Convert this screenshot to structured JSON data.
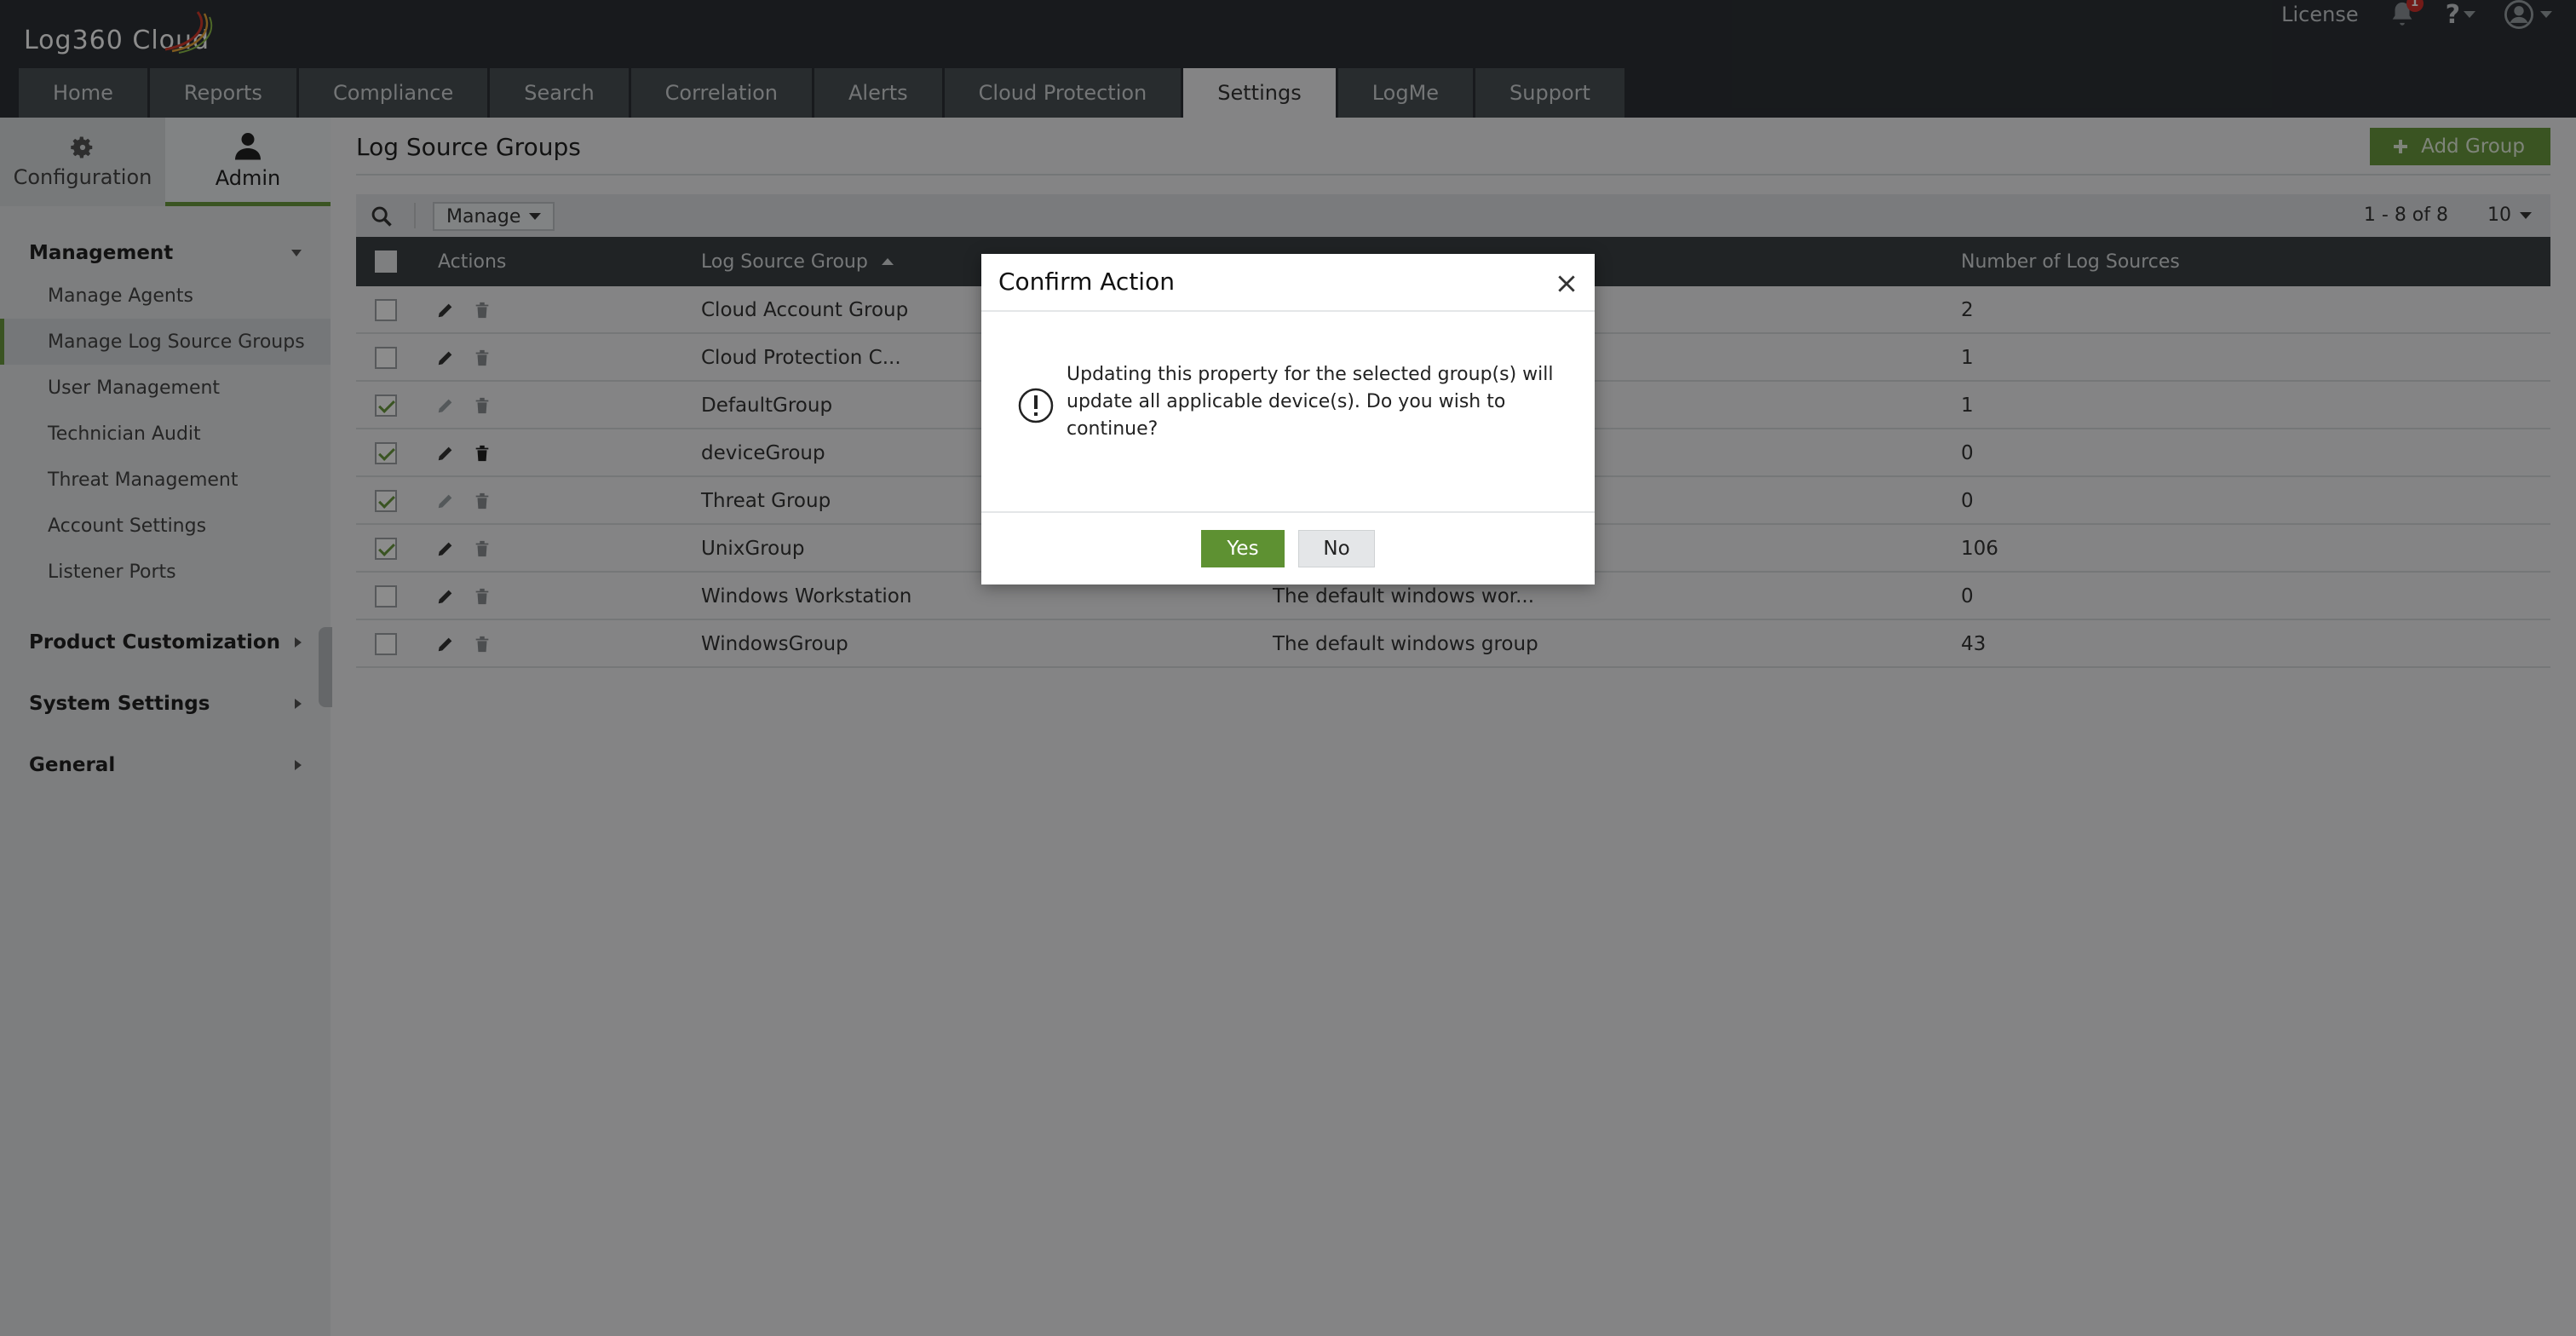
{
  "app": {
    "logo_text": "Log360 Cloud"
  },
  "header": {
    "license_label": "License",
    "notification_count": "1"
  },
  "nav": {
    "tabs": [
      {
        "label": "Home"
      },
      {
        "label": "Reports"
      },
      {
        "label": "Compliance"
      },
      {
        "label": "Search"
      },
      {
        "label": "Correlation"
      },
      {
        "label": "Alerts"
      },
      {
        "label": "Cloud Protection"
      },
      {
        "label": "Settings",
        "active": true
      },
      {
        "label": "LogMe"
      },
      {
        "label": "Support"
      }
    ]
  },
  "sidebar": {
    "top_tabs": [
      {
        "label": "Configuration",
        "icon": "gear-icon"
      },
      {
        "label": "Admin",
        "icon": "user-icon",
        "active": true
      }
    ],
    "management_label": "Management",
    "management_items": [
      {
        "label": "Manage Agents"
      },
      {
        "label": "Manage Log Source Groups",
        "active": true
      },
      {
        "label": "User Management"
      },
      {
        "label": "Technician Audit"
      },
      {
        "label": "Threat Management"
      },
      {
        "label": "Account Settings"
      },
      {
        "label": "Listener Ports"
      }
    ],
    "sections": [
      {
        "label": "Product Customization"
      },
      {
        "label": "System Settings"
      },
      {
        "label": "General"
      }
    ]
  },
  "main": {
    "title": "Log Source Groups",
    "add_button_label": "Add Group",
    "manage_label": "Manage",
    "pager_text": "1 - 8 of 8",
    "page_size": "10",
    "columns": {
      "actions": "Actions",
      "group": "Log Source Group",
      "count": "Number of Log Sources"
    },
    "rows": [
      {
        "name": "Cloud Account Group",
        "description": "",
        "count": "2",
        "checked": false
      },
      {
        "name": "Cloud Protection C...",
        "description": "",
        "count": "1",
        "checked": false
      },
      {
        "name": "DefaultGroup",
        "description": "",
        "count": "1",
        "checked": true
      },
      {
        "name": "deviceGroup",
        "description": "",
        "count": "0",
        "checked": true
      },
      {
        "name": "Threat Group",
        "description": "",
        "count": "0",
        "checked": true
      },
      {
        "name": "UnixGroup",
        "description": "",
        "count": "106",
        "checked": true
      },
      {
        "name": "Windows Workstation",
        "description": "The default windows wor...",
        "count": "0",
        "checked": false
      },
      {
        "name": "WindowsGroup",
        "description": "The default windows group",
        "count": "43",
        "checked": false
      }
    ]
  },
  "modal": {
    "title": "Confirm Action",
    "message": "Updating this property for the selected group(s) will update all applicable device(s). Do you wish to continue?",
    "yes_label": "Yes",
    "no_label": "No"
  },
  "colors": {
    "accent_green": "#6a9a3f",
    "header_bg": "#2c3135",
    "table_header_bg": "#3b4044"
  }
}
